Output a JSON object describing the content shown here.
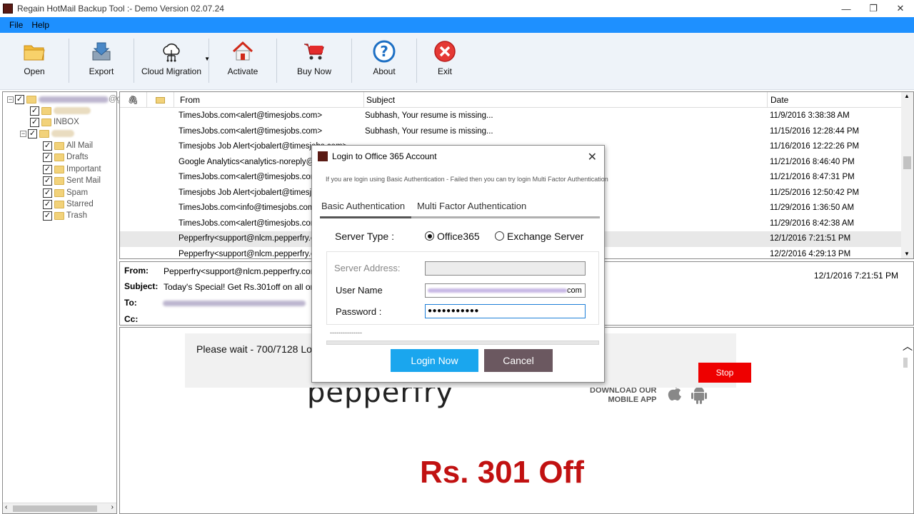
{
  "window": {
    "title": "Regain HotMail Backup Tool :- Demo Version 02.07.24",
    "minimize_glyph": "—",
    "maximize_glyph": "❐",
    "close_glyph": "✕"
  },
  "menu": {
    "file": "File",
    "help": "Help"
  },
  "toolbar": {
    "open": "Open",
    "export": "Export",
    "cloud_migration": "Cloud Migration",
    "activate": "Activate",
    "buy_now": "Buy Now",
    "about": "About",
    "exit": "Exit"
  },
  "tree": {
    "items": [
      {
        "label": "INBOX"
      },
      {
        "label": "All Mail"
      },
      {
        "label": "Drafts"
      },
      {
        "label": "Important"
      },
      {
        "label": "Sent Mail"
      },
      {
        "label": "Spam"
      },
      {
        "label": "Starred"
      },
      {
        "label": "Trash"
      }
    ]
  },
  "maillist": {
    "headers": {
      "from": "From",
      "subject": "Subject",
      "date": "Date"
    },
    "rows": [
      {
        "from": "TimesJobs.com<alert@timesjobs.com>",
        "subject": "Subhash, Your resume is missing...",
        "date": "11/9/2016 3:38:38 AM"
      },
      {
        "from": "TimesJobs.com<alert@timesjobs.com>",
        "subject": "Subhash, Your resume is missing...",
        "date": "11/15/2016 12:28:44 PM"
      },
      {
        "from": "Timesjobs Job Alert<jobalert@timesjobs.com>",
        "subject": "",
        "date": "11/16/2016 12:22:26 PM"
      },
      {
        "from": "Google Analytics<analytics-noreply@google.com>",
        "subject": "",
        "date": "11/21/2016 8:46:40 PM"
      },
      {
        "from": "TimesJobs.com<alert@timesjobs.com>",
        "subject": "",
        "date": "11/21/2016 8:47:31 PM"
      },
      {
        "from": "Timesjobs Job Alert<jobalert@timesjobs.com>",
        "subject": "",
        "date": "11/25/2016 12:50:42 PM"
      },
      {
        "from": "TimesJobs.com<info@timesjobs.com>",
        "subject": "",
        "date": "11/29/2016 1:36:50 AM"
      },
      {
        "from": "TimesJobs.com<alert@timesjobs.com>",
        "subject": "",
        "date": "11/29/2016 8:42:38 AM"
      },
      {
        "from": "Pepperfry<support@nlcm.pepperfry.com>",
        "subject": "",
        "date": "12/1/2016 7:21:51 PM"
      },
      {
        "from": "Pepperfry<support@nlcm.pepperfry.com>",
        "subject": "",
        "date": "12/2/2016 4:29:13 PM"
      }
    ]
  },
  "preview": {
    "from_label": "From:",
    "subject_label": "Subject:",
    "to_label": "To:",
    "cc_label": "Cc:",
    "from_value": "Pepperfry<support@nlcm.pepperfry.com>",
    "subject_value": "Today's Special! Get Rs.301off on all orders abo",
    "date_value": "12/1/2016 7:21:51 PM"
  },
  "body": {
    "please_wait": "Please wait - 700/7128 Loa",
    "stop": "Stop",
    "brand": "pepperfry",
    "download_line1": "DOWNLOAD OUR",
    "download_line2": "MOBILE APP",
    "offer": "Rs. 301 Off"
  },
  "dialog": {
    "title": "Login to Office 365 Account",
    "info": "If you are login using Basic Authentication - Failed then you can try login Multi Factor Authentication",
    "tab_basic": "Basic Authentication",
    "tab_mfa": "Multi Factor Authentication",
    "server_type_label": "Server Type :",
    "option_office365": "Office365",
    "option_exchange": "Exchange Server",
    "server_address_label": "Server Address:",
    "user_name_label": "User Name",
    "user_name_value": "com",
    "password_label": "Password :",
    "password_value": "●●●●●●●●●●●",
    "progress_text": "---------------",
    "login_button": "Login Now",
    "cancel_button": "Cancel"
  }
}
